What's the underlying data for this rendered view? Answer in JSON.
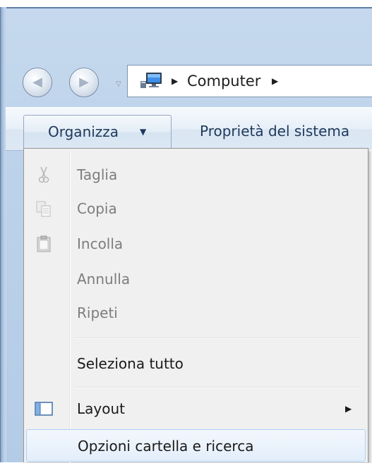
{
  "navigation": {
    "back_glyph": "◀",
    "forward_glyph": "▶",
    "history_glyph": "▽"
  },
  "address": {
    "icon": "computer-icon",
    "segments": [
      "Computer"
    ],
    "separator": "▶"
  },
  "command_bar": {
    "organize_label": "Organizza",
    "organize_caret": "▼",
    "system_properties_label": "Proprietà del sistema"
  },
  "menu": {
    "items": [
      {
        "label": "Taglia",
        "icon": "scissors-icon",
        "enabled": false
      },
      {
        "label": "Copia",
        "icon": "copy-icon",
        "enabled": false
      },
      {
        "label": "Incolla",
        "icon": "clipboard-icon",
        "enabled": false
      },
      {
        "label": "Annulla",
        "icon": "",
        "enabled": false
      },
      {
        "label": "Ripeti",
        "icon": "",
        "enabled": false
      },
      {
        "label": "Seleziona tutto",
        "icon": "",
        "enabled": true
      },
      {
        "label": "Layout",
        "icon": "layout-icon",
        "enabled": true,
        "submenu": "▶"
      },
      {
        "label": "Opzioni cartella e ricerca",
        "icon": "",
        "enabled": true,
        "highlighted": true
      }
    ]
  },
  "colors": {
    "chrome": "#bcd2ea",
    "command_text": "#1e395b",
    "menu_bg": "#f0f0f0",
    "disabled_text": "#7d7d7d"
  }
}
